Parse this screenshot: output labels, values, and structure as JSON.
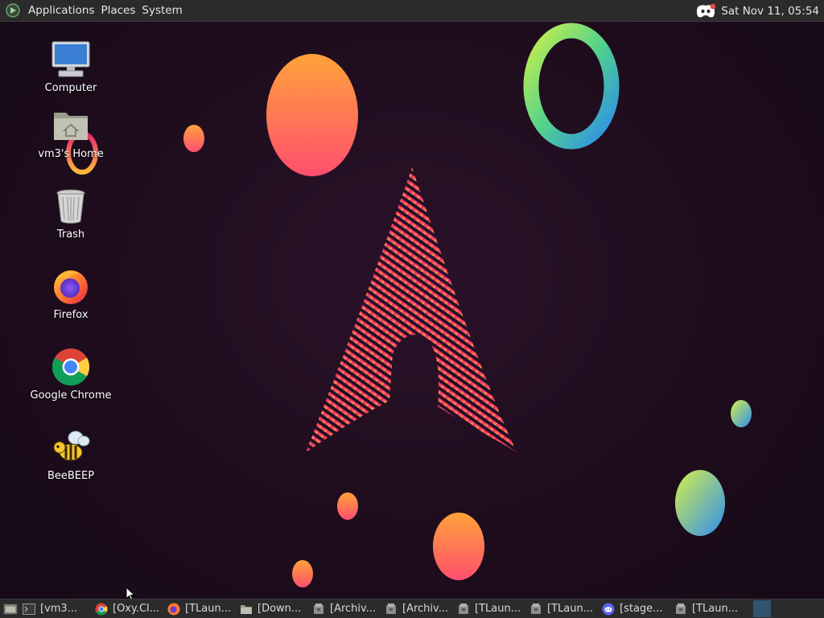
{
  "top_panel": {
    "menus": [
      "Applications",
      "Places",
      "System"
    ],
    "clock": "Sat Nov 11, 05:54",
    "tray_icon": "discord-icon"
  },
  "desktop_icons": [
    {
      "label": "Computer",
      "icon": "computer-icon"
    },
    {
      "label": "vm3's Home",
      "icon": "home-folder-icon"
    },
    {
      "label": "Trash",
      "icon": "trash-icon"
    },
    {
      "label": "Firefox",
      "icon": "firefox-icon"
    },
    {
      "label": "Google Chrome",
      "icon": "chrome-icon"
    },
    {
      "label": "BeeBEEP",
      "icon": "beebeep-icon"
    }
  ],
  "taskbar": {
    "tasks": [
      {
        "label": "[vm3...",
        "icon": "terminal-icon"
      },
      {
        "label": "[Oxy.Cl...",
        "icon": "chrome-icon"
      },
      {
        "label": "[TLaun...",
        "icon": "firefox-icon"
      },
      {
        "label": "[Down...",
        "icon": "folder-icon"
      },
      {
        "label": "[Archiv...",
        "icon": "archive-icon"
      },
      {
        "label": "[Archiv...",
        "icon": "archive-icon"
      },
      {
        "label": "[TLaun...",
        "icon": "archive-icon"
      },
      {
        "label": "[TLaun...",
        "icon": "archive-icon"
      },
      {
        "label": "[stage...",
        "icon": "discord-icon"
      },
      {
        "label": "[TLaun...",
        "icon": "archive-icon"
      }
    ]
  },
  "colors": {
    "panel": "#2b2b2b",
    "wallpaper": "#1d0c1c",
    "accent_pink": "#e8256e",
    "accent_orange": "#ff9a3c",
    "workspace": "#2f5470"
  }
}
